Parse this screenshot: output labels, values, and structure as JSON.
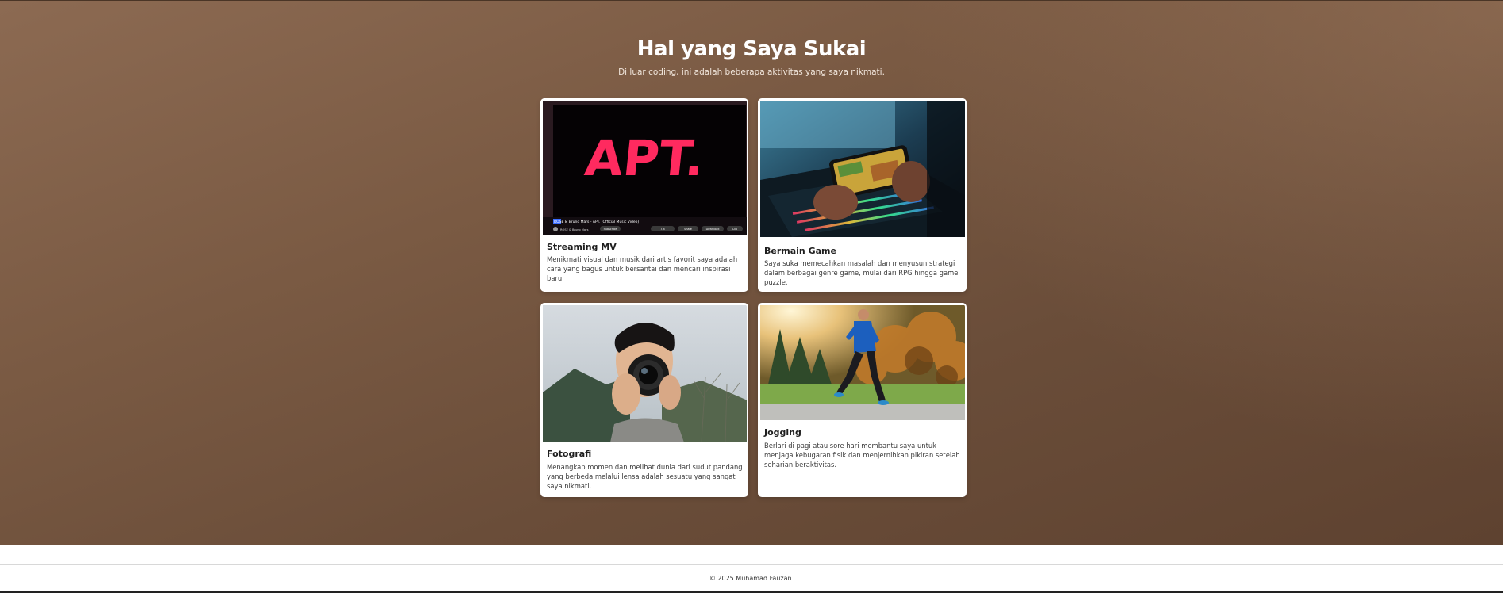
{
  "section": {
    "title": "Hal yang Saya Sukai",
    "subtitle": "Di luar coding, ini adalah beberapa aktivitas yang saya nikmati."
  },
  "cards": [
    {
      "title": "Streaming MV",
      "description": "Menikmati visual dan musik dari artis favorit saya adalah cara yang bagus untuk bersantai dan mencari inspirasi baru.",
      "image_caption": "ROSÉ & Bruno Mars - APT. (Official Music Video)",
      "image_text": "APT.",
      "image_channel": "ROSÉ & Bruno Mars",
      "image_subscribe": "Subscribe",
      "image_actions": [
        "7.8",
        "Share",
        "Download",
        "Clip"
      ]
    },
    {
      "title": "Bermain Game",
      "description": "Saya suka memecahkan masalah dan menyusun strategi dalam berbagai genre game, mulai dari RPG hingga game puzzle."
    },
    {
      "title": "Fotografi",
      "description": "Menangkap momen dan melihat dunia dari sudut pandang yang berbeda melalui lensa adalah sesuatu yang sangat saya nikmati."
    },
    {
      "title": "Jogging",
      "description": "Berlari di pagi atau sore hari membantu saya untuk menjaga kebugaran fisik dan menjernihkan pikiran setelah seharian beraktivitas."
    }
  ],
  "footer": {
    "text": "© 2025 Muhamad Fauzan."
  }
}
